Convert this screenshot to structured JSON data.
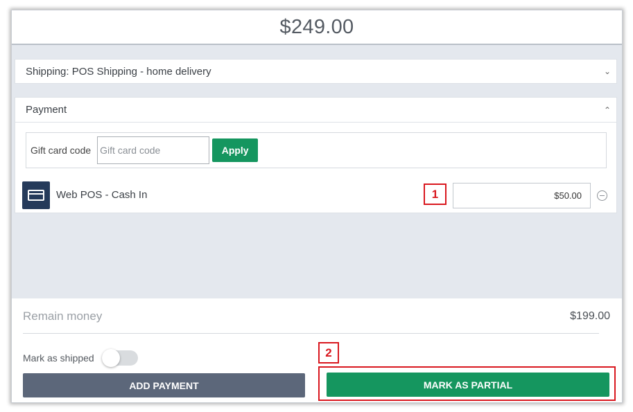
{
  "order": {
    "total": "$249.00"
  },
  "shipping": {
    "label": "Shipping: POS Shipping - home delivery",
    "chevron_icon": "chevron-down-icon"
  },
  "payment": {
    "title": "Payment",
    "chevron_icon": "chevron-up-icon",
    "gift_card": {
      "label": "Gift card code",
      "placeholder": "Gift card code",
      "value": "",
      "apply_label": "Apply"
    },
    "methods": [
      {
        "name": "Web POS - Cash In",
        "icon": "credit-card-icon",
        "amount": "$50.00"
      }
    ]
  },
  "summary": {
    "remain_label": "Remain money",
    "remain_value": "$199.00",
    "mark_shipped_label": "Mark as shipped",
    "mark_shipped_on": false
  },
  "actions": {
    "add_payment_label": "ADD PAYMENT",
    "mark_partial_label": "MARK AS PARTIAL"
  },
  "annotations": {
    "callout_1": "1",
    "callout_2": "2"
  },
  "colors": {
    "primary_green": "#15965f",
    "secondary_gray": "#5c677a",
    "icon_navy": "#253a5a",
    "callout_red": "#d9171e",
    "panel_background": "#e4e8ee"
  }
}
